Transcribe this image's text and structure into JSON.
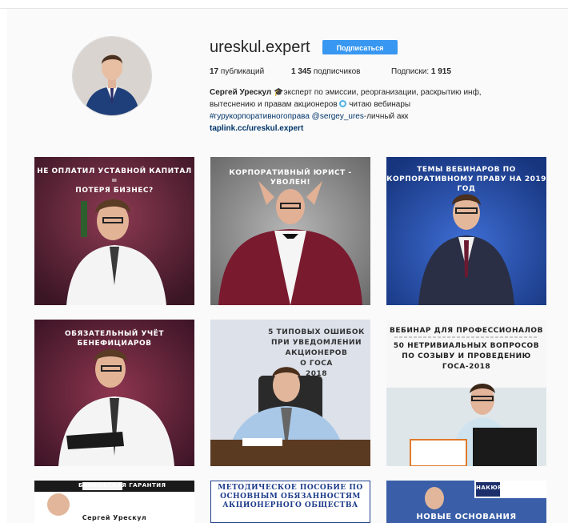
{
  "profile": {
    "username": "ureskul.expert",
    "follow_label": "Подписаться",
    "stats": {
      "posts_value": "17",
      "posts_label": "публикаций",
      "followers_value": "1 345",
      "followers_label": "подписчиков",
      "following_label": "Подписки:",
      "following_value": "1 915"
    },
    "bio": {
      "name": "Сергей Урескул",
      "line1_rest": " 🎓эксперт по эмиссии, реорганизации, раскрытию инф,",
      "line2": "вытеснению и правам акционеров",
      "line2_tail": " читаю вебинары",
      "hashtag": "#гурукорпоративногоправа",
      "mention": "@sergey_ures",
      "mention_tail": "-личный акк",
      "link": "taplink.cc/ureskul.expert"
    }
  },
  "posts": [
    {
      "caption": [
        "НЕ ОПЛАТИЛ УСТАВНОЙ КАПИТАЛ =",
        "ПОТЕРЯ БИЗНЕС?"
      ]
    },
    {
      "caption": [
        "КОРПОРАТИВНЫЙ ЮРИСТ - УВОЛЕН!"
      ]
    },
    {
      "caption": [
        "ТЕМЫ ВЕБИНАРОВ ПО",
        "КОРПОРАТИВНОМУ ПРАВУ НА 2019 ГОД"
      ]
    },
    {
      "caption": [
        "ОБЯЗАТЕЛЬНЫЙ УЧЁТ БЕНЕФИЦИАРОВ"
      ]
    },
    {
      "caption": [
        "5 ТИПОВЫХ ОШИБОК",
        "ПРИ УВЕДОМЛЕНИИ",
        "АКЦИОНЕРОВ",
        "О ГОСА",
        "2018"
      ]
    },
    {
      "caption": [
        "ВЕБИНАР ДЛЯ ПРОФЕССИОНАЛОВ",
        "50 НЕТРИВИАЛЬНЫХ ВОПРОСОВ",
        "ПО СОЗЫВУ И ПРОВЕДЕНИЮ",
        "ГОСА-2018"
      ]
    },
    {
      "caption": [
        "БАНКОВСКАЯ ГАРАНТИЯ",
        "Сергей Урескул"
      ]
    },
    {
      "caption": [
        "МЕТОДИЧЕСКОЕ ПОСОБИЕ ПО",
        "ОСНОВНЫМ ОБЯЗАННОСТЯМ",
        "АКЦИОНЕРНОГО ОБЩЕСТВА"
      ]
    },
    {
      "caption": [
        "НАКЮР",
        "НОВЫЕ ОСНОВАНИЯ"
      ]
    }
  ]
}
